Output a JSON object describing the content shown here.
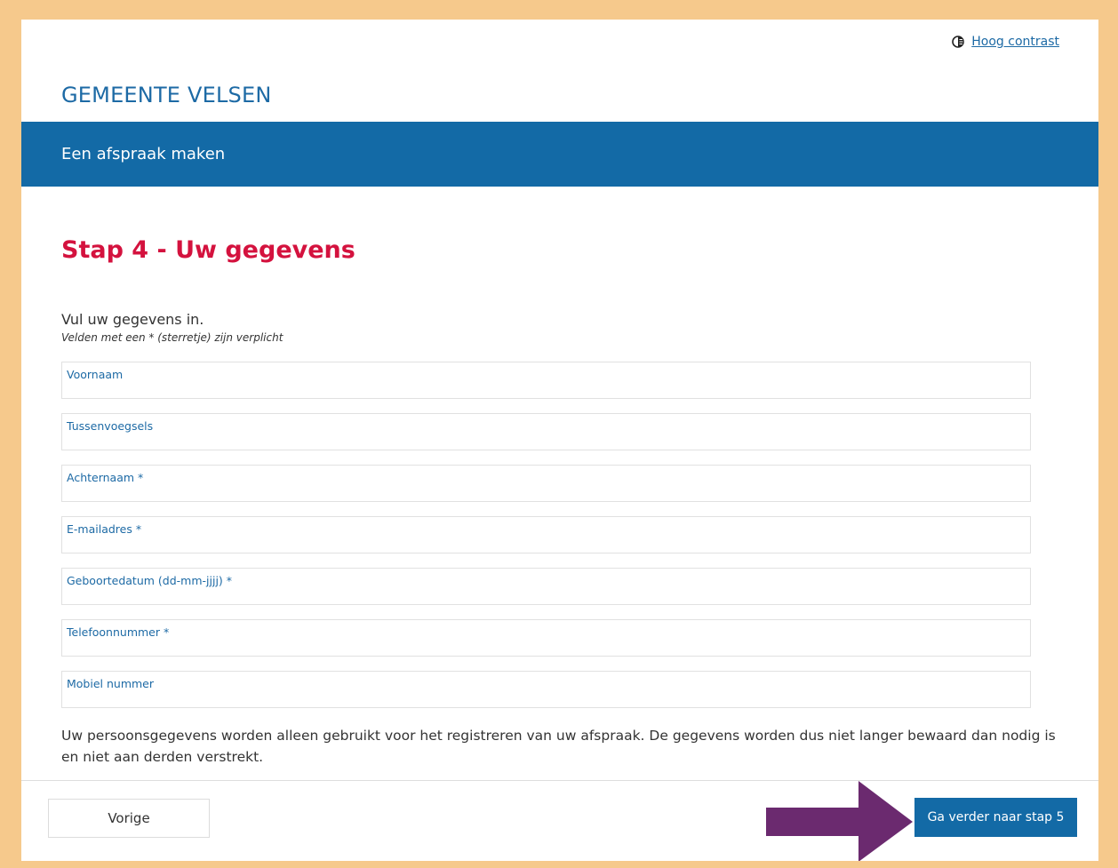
{
  "header": {
    "contrast_label": "Hoog contrast",
    "site_title": "GEMEENTE VELSEN"
  },
  "banner": {
    "title": "Een afspraak maken"
  },
  "form": {
    "step_title": "Stap 4 - Uw gegevens",
    "intro": "Vul uw gegevens in.",
    "required_note": "Velden met een * (sterretje) zijn verplicht",
    "fields": [
      {
        "label": "Voornaam",
        "value": ""
      },
      {
        "label": "Tussenvoegsels",
        "value": ""
      },
      {
        "label": "Achternaam *",
        "value": ""
      },
      {
        "label": "E-mailadres *",
        "value": ""
      },
      {
        "label": "Geboortedatum (dd-mm-jjjj) *",
        "value": ""
      },
      {
        "label": "Telefoonnummer *",
        "value": ""
      },
      {
        "label": "Mobiel nummer",
        "value": ""
      }
    ],
    "privacy_text": "Uw persoonsgegevens worden alleen gebruikt voor het registreren van uw afspraak. De gegevens worden dus niet langer bewaard dan nodig is en niet aan derden verstrekt."
  },
  "footer": {
    "prev_label": "Vorige",
    "next_label": "Ga verder naar stap 5"
  },
  "colors": {
    "frame_border": "#f6c98c",
    "brand_blue": "#136aa6",
    "title_red": "#d4123e",
    "arrow_purple": "#6b2a6f"
  },
  "icons": {
    "contrast": "contrast-icon",
    "arrow": "arrow-right-icon"
  }
}
